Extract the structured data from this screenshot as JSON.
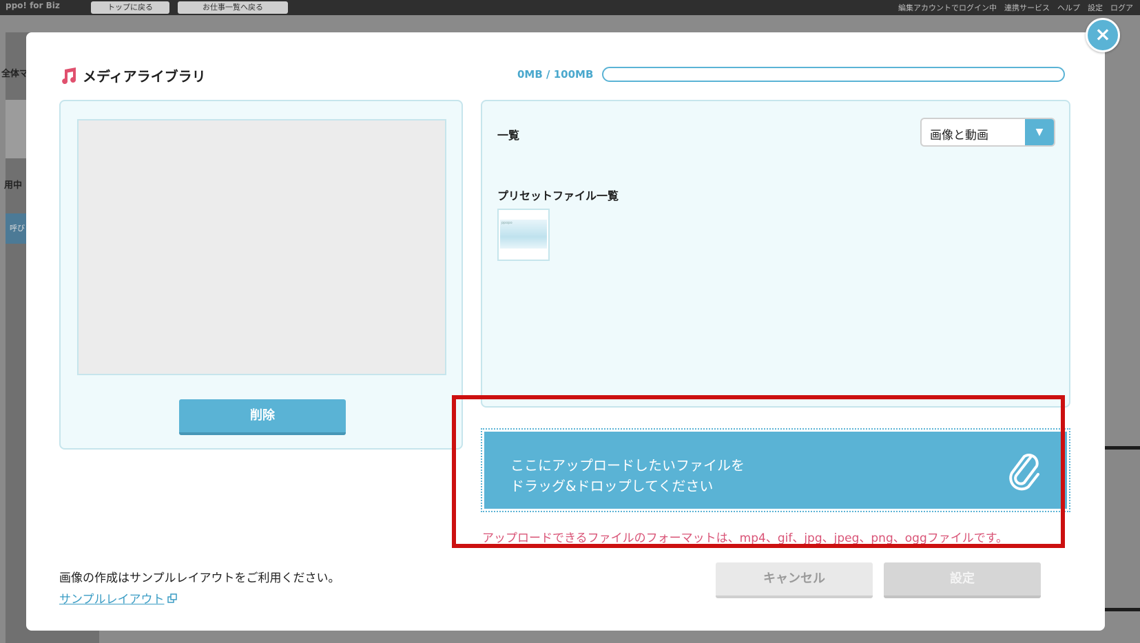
{
  "background": {
    "logo": "ppo! for Biz",
    "buttons": [
      "トップに戻る",
      "お仕事一覧へ戻る"
    ],
    "right_links": "編集アカウントでログイン中　連携サービス　ヘルプ　設定　ログア",
    "left_texts": [
      "全体マ",
      "用中",
      "呼び"
    ]
  },
  "modal": {
    "title": "メディアライブラリ",
    "title_icon": "music-note-icon",
    "storage": {
      "text": "0MB / 100MB",
      "used_fraction": 0.0
    },
    "left_panel": {
      "delete_label": "削除"
    },
    "right_panel": {
      "list_label": "一覧",
      "filter_selected": "画像と動画",
      "preset_label": "プリセットファイル一覧",
      "thumbnail_text": "ppopo"
    },
    "dropzone": {
      "line1": "ここにアップロードしたいファイルを",
      "line2": "ドラッグ&ドロップしてください",
      "icon": "paperclip-icon"
    },
    "format_note": "アップロードできるファイルのフォーマットは、mp4、gif、jpg、jpeg、png、oggファイルです。",
    "footer": {
      "note": "画像の作成はサンプルレイアウトをご利用ください。",
      "link": "サンプルレイアウト",
      "cancel_label": "キャンセル",
      "ok_label": "設定"
    }
  },
  "colors": {
    "accent": "#5ab3d5",
    "panel_bg": "#effafc",
    "warning_text": "#d95376",
    "highlight_box": "#cc1010"
  }
}
